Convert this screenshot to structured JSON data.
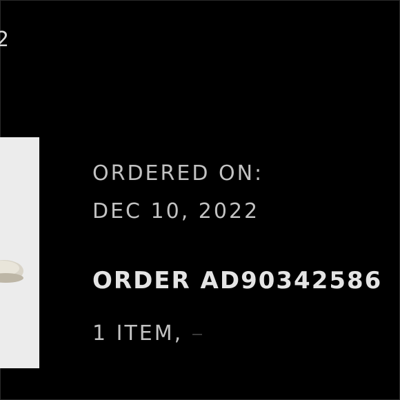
{
  "header": {
    "fragment": "2"
  },
  "order": {
    "ordered_on_label": "ORDERED ON:",
    "date": "DEC 10, 2022",
    "number": "ORDER AD90342586",
    "items": "1 ITEM,"
  },
  "product": {
    "image": "sneaker-thumbnail"
  },
  "colors": {
    "background": "#000000",
    "text": "#c2c2c2",
    "card": "#ececec"
  }
}
